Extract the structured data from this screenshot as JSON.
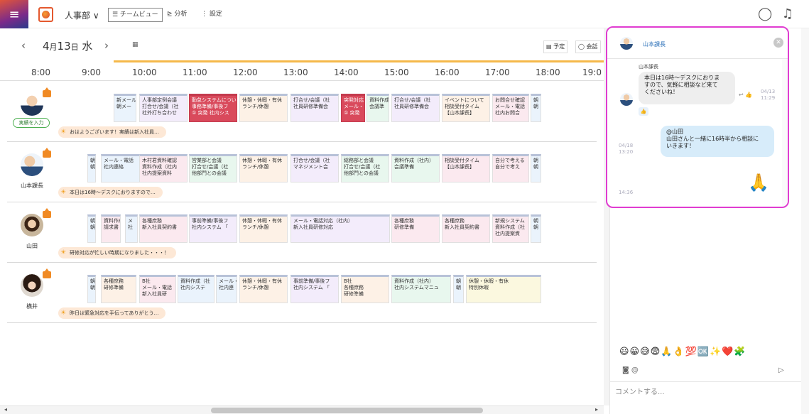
{
  "header": {
    "dept": "人事部 ∨",
    "tabs": [
      {
        "label": "☰ チームビュー",
        "active": true
      },
      {
        "label": "⊵ 分析",
        "active": false
      },
      {
        "label": "⋮ 設定",
        "active": false
      }
    ]
  },
  "datebar": {
    "prev": "‹",
    "month": "4",
    "month_unit": "月",
    "day": "13",
    "day_unit": "日",
    "weekday": "水",
    "next": "›",
    "cal": "▦",
    "btn_schedule": "▤ 予定",
    "btn_chat": "◯ 会話"
  },
  "hours": [
    "8:00",
    "9:00",
    "10:00",
    "11:00",
    "12:00",
    "13:00",
    "14:00",
    "15:00",
    "16:00",
    "17:00",
    "18:00",
    "19:0"
  ],
  "people": [
    {
      "name": "",
      "action": "実績を入力",
      "memo": "おはようございます！実績は新入社員…",
      "events": [
        {
          "t": "新メール\n朝メー",
          "c": "c-blue"
        },
        {
          "t": "人事部定例会議\n打合せ/会議（社\n社外打ち合わせ",
          "c": "c-lav"
        },
        {
          "t": "勤怠システムについ\n事務準備/事後フ\n① 突発 社内シス",
          "c": "c-red"
        },
        {
          "t": "休憩・休暇・有休\nランチ/休憩",
          "c": "c-peach"
        },
        {
          "t": "打合せ/会議（社\n社員研修準備会",
          "c": "c-lav"
        },
        {
          "t": "突発対応\nメール・\n① 突発",
          "c": "c-red"
        },
        {
          "t": "資料作成\n会議準",
          "c": "c-green"
        },
        {
          "t": "打合せ/会議（社\n社員研修準備会",
          "c": "c-lav"
        },
        {
          "t": "イベントについて\n相談受付タイム\n【山本課長】",
          "c": "c-peach"
        },
        {
          "t": "お問合せ確認\nメール・電話\n社内お問合",
          "c": "c-pink"
        },
        {
          "t": "朝\n朝",
          "c": "c-blue"
        }
      ]
    },
    {
      "name": "山本課長",
      "memo": "本日は16時～デスクにおりますので…",
      "events": [
        {
          "t": "朝\n朝",
          "c": "c-blue"
        },
        {
          "t": "メール・電話\n社内連絡",
          "c": "c-blue"
        },
        {
          "t": "木村君資料確認\n資料作成（社内\n社内提案資料",
          "c": "c-pink"
        },
        {
          "t": "営業部と会議\n打合せ/会議（社\n他部門との会議",
          "c": "c-green"
        },
        {
          "t": "休憩・休暇・有休\nランチ/休憩",
          "c": "c-peach"
        },
        {
          "t": "打合せ/会議（社\nマネジメント会",
          "c": "c-lav"
        },
        {
          "t": "総務部と会議\n打合せ/会議（社\n他部門との会議",
          "c": "c-green"
        },
        {
          "t": "資料作成（社内）\n会議準備",
          "c": "c-green"
        },
        {
          "t": "相談受付タイム\n【山本課長】",
          "c": "c-pink"
        },
        {
          "t": "自分で考える\n自分で考え",
          "c": "c-pink"
        },
        {
          "t": "朝\n朝",
          "c": "c-blue"
        }
      ]
    },
    {
      "name": "山田",
      "memo": "研修対応が忙しい時期になりました・・・！",
      "events": [
        {
          "t": "朝\n朝",
          "c": "c-blue"
        },
        {
          "t": "資料作成\n請求書",
          "c": "c-pink"
        },
        {
          "t": "メ\n社",
          "c": "c-blue"
        },
        {
          "t": "各種庶務\n新入社員契約書",
          "c": "c-pink"
        },
        {
          "t": "事前準備/事後フ\n社内システム 「",
          "c": "c-lav"
        },
        {
          "t": "休憩・休暇・有休\nランチ/休憩",
          "c": "c-peach"
        },
        {
          "t": "メール・電話対応（社内）\n新入社員研修対応",
          "c": "c-lav"
        },
        {
          "t": "各種庶務\n研修準備",
          "c": "c-pink"
        },
        {
          "t": "各種庶務\n新入社員契約書",
          "c": "c-pink"
        },
        {
          "t": "新規システム\n資料作成（社\n社内提案資",
          "c": "c-pink"
        },
        {
          "t": "朝\n朝",
          "c": "c-blue"
        }
      ]
    },
    {
      "name": "横井",
      "memo": "昨日は緊急対応を手伝ってありがとう…",
      "events": [
        {
          "t": "朝\n朝",
          "c": "c-blue"
        },
        {
          "t": "各種庶務\n研修準備",
          "c": "c-peach"
        },
        {
          "t": "B社\nメール・電話\n新入社員研",
          "c": "c-pink"
        },
        {
          "t": "資料作成（社\n社内システ",
          "c": "c-blue"
        },
        {
          "t": "メール・\n社内連",
          "c": "c-blue"
        },
        {
          "t": "休憩・休暇・有休\nランチ/休憩",
          "c": "c-peach"
        },
        {
          "t": "事前準備/事後フ\n社内システム 「",
          "c": "c-lav"
        },
        {
          "t": "B社\n各種庶務\n研修準備",
          "c": "c-peach"
        },
        {
          "t": "資料作成（社内）\n社内システムマニュ",
          "c": "c-green"
        },
        {
          "t": "朝\n朝",
          "c": "c-blue"
        },
        {
          "t": "休憩・休暇・有休\n特別休暇",
          "c": "c-yel"
        }
      ]
    }
  ],
  "chat": {
    "header_name": "山本課長",
    "sender": "山本課長",
    "msg1": "本日は16時～デスクにおりま\nすので、気軽に相談など来て\nくださいね！",
    "msg1_time": "04/13\n11:29",
    "msg1_icons": "↩ 👍",
    "reaction": "👍",
    "msg2": "@山田\n山田さんと一緒に16時半から相談に\nいきます！",
    "msg2_time": "04/18\n13:20",
    "big_emoji": "🙏",
    "msg3_time": "14:36",
    "emojis": "😃😀😅😨🙏👌💯🆗✨❤️🧩",
    "tools": "◙  @",
    "send": "▷",
    "placeholder": "コメントする..."
  }
}
